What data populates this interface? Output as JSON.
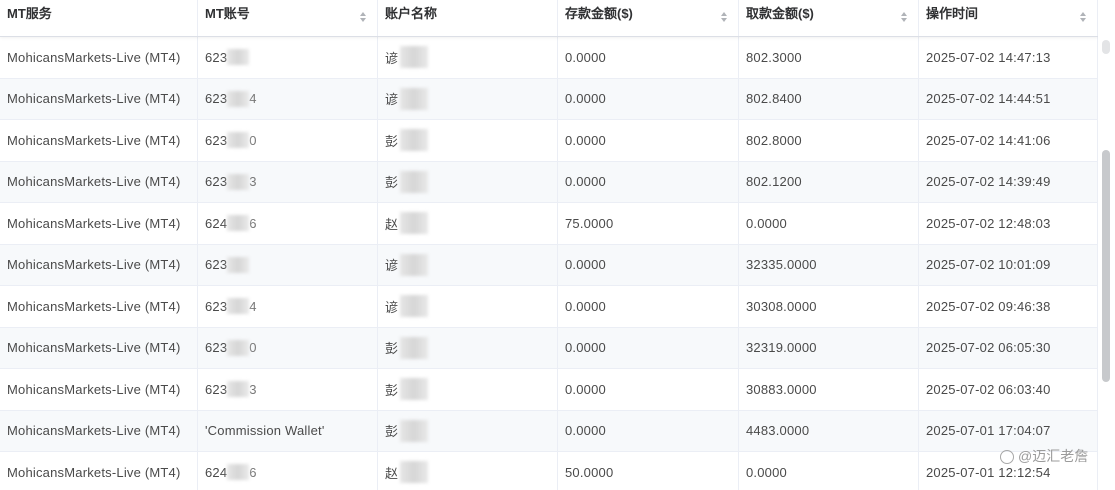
{
  "columns": [
    {
      "label": "MT服务",
      "sortable": false
    },
    {
      "label": "MT账号",
      "sortable": true
    },
    {
      "label": "账户名称",
      "sortable": false
    },
    {
      "label": "存款金额($)",
      "sortable": true
    },
    {
      "label": "取款金额($)",
      "sortable": true
    },
    {
      "label": "操作时间",
      "sortable": true
    }
  ],
  "rows": [
    {
      "service": "MohicansMarkets-Live (MT4)",
      "account_prefix": "623",
      "account_suffix": "",
      "name_prefix": "谚",
      "deposit": "0.0000",
      "withdrawal": "802.3000",
      "time": "2025-07-02 14:47:13"
    },
    {
      "service": "MohicansMarkets-Live (MT4)",
      "account_prefix": "623",
      "account_suffix": "4",
      "name_prefix": "谚",
      "deposit": "0.0000",
      "withdrawal": "802.8400",
      "time": "2025-07-02 14:44:51"
    },
    {
      "service": "MohicansMarkets-Live (MT4)",
      "account_prefix": "623",
      "account_suffix": "0",
      "name_prefix": "彭",
      "deposit": "0.0000",
      "withdrawal": "802.8000",
      "time": "2025-07-02 14:41:06"
    },
    {
      "service": "MohicansMarkets-Live (MT4)",
      "account_prefix": "623",
      "account_suffix": "3",
      "name_prefix": "彭",
      "deposit": "0.0000",
      "withdrawal": "802.1200",
      "time": "2025-07-02 14:39:49"
    },
    {
      "service": "MohicansMarkets-Live (MT4)",
      "account_prefix": "624",
      "account_suffix": "6",
      "name_prefix": "赵",
      "deposit": "75.0000",
      "withdrawal": "0.0000",
      "time": "2025-07-02 12:48:03"
    },
    {
      "service": "MohicansMarkets-Live (MT4)",
      "account_prefix": "623",
      "account_suffix": "",
      "name_prefix": "谚",
      "deposit": "0.0000",
      "withdrawal": "32335.0000",
      "time": "2025-07-02 10:01:09"
    },
    {
      "service": "MohicansMarkets-Live (MT4)",
      "account_prefix": "623",
      "account_suffix": "4",
      "name_prefix": "谚",
      "deposit": "0.0000",
      "withdrawal": "30308.0000",
      "time": "2025-07-02 09:46:38"
    },
    {
      "service": "MohicansMarkets-Live (MT4)",
      "account_prefix": "623",
      "account_suffix": "0",
      "name_prefix": "彭",
      "deposit": "0.0000",
      "withdrawal": "32319.0000",
      "time": "2025-07-02 06:05:30"
    },
    {
      "service": "MohicansMarkets-Live (MT4)",
      "account_prefix": "623",
      "account_suffix": "3",
      "name_prefix": "彭",
      "deposit": "0.0000",
      "withdrawal": "30883.0000",
      "time": "2025-07-02 06:03:40"
    },
    {
      "service": "MohicansMarkets-Live (MT4)",
      "account_prefix": "'Commission Wallet'",
      "account_suffix": "",
      "name_prefix": "彭",
      "deposit": "0.0000",
      "withdrawal": "4483.0000",
      "time": "2025-07-01 17:04:07"
    },
    {
      "service": "MohicansMarkets-Live (MT4)",
      "account_prefix": "624",
      "account_suffix": "6",
      "name_prefix": "赵",
      "deposit": "50.0000",
      "withdrawal": "0.0000",
      "time": "2025-07-01 12:12:54"
    }
  ],
  "watermark": "@迈汇老詹",
  "colors": {
    "header_text": "#303133",
    "cell_text": "#4a4a4a",
    "row_alt_bg": "#f7f9fb",
    "border": "#ebeef5"
  }
}
